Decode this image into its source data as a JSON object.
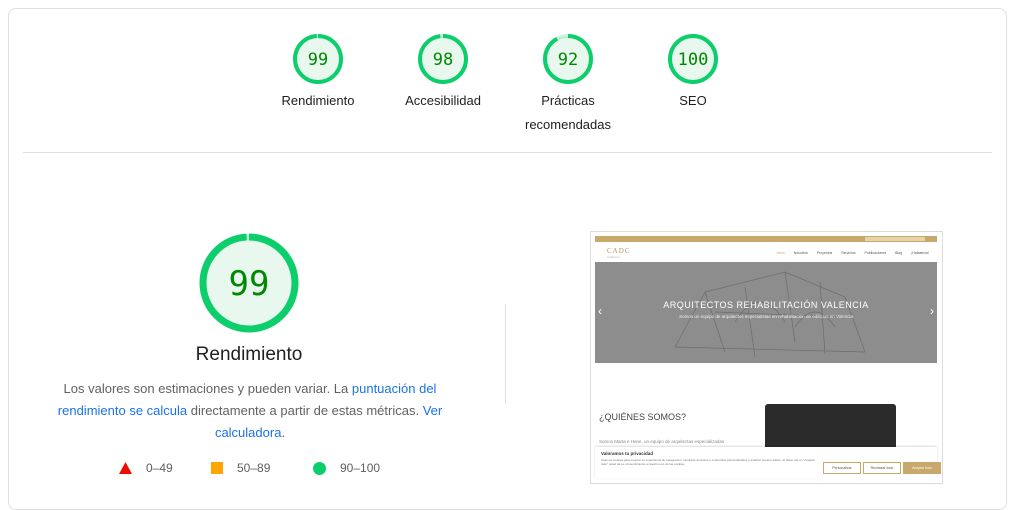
{
  "categories": [
    {
      "score": "99",
      "label": "Rendimiento",
      "fraction": 0.99
    },
    {
      "score": "98",
      "label": "Accesibilidad",
      "fraction": 0.98
    },
    {
      "score": "92",
      "label": "Prácticas recomendadas",
      "fraction": 0.92
    },
    {
      "score": "100",
      "label": "SEO",
      "fraction": 1.0
    }
  ],
  "main": {
    "score": "99",
    "fraction": 0.99,
    "title": "Rendimiento",
    "desc_before": "Los valores son estimaciones y pueden variar. La ",
    "desc_link1": "puntuación del rendimiento se calcula",
    "desc_middle": " directamente a partir de estas métricas. ",
    "desc_link2": "Ver calculadora",
    "desc_after": "."
  },
  "legend": [
    {
      "range": "0–49",
      "icon": "red-triangle-icon",
      "color": "#eb0f00"
    },
    {
      "range": "50–89",
      "icon": "orange-square-icon",
      "color": "#ffa400"
    },
    {
      "range": "90–100",
      "icon": "green-circle-icon",
      "color": "#0cce6b"
    }
  ],
  "colors": {
    "pass": "#0cce6b",
    "pass_fill": "#e8f8ee",
    "pass_text": "#008800",
    "link": "#1a73e8"
  },
  "screenshot": {
    "logo": "CADC",
    "logo_sub": "arquitectos",
    "menu": [
      "Inicio",
      "Nosotros",
      "Proyectos",
      "Servicios",
      "Publicaciones",
      "Blog",
      "¡Hablamos!"
    ],
    "hero_title": "ARQUITECTOS REHABILITACIÓN VALENCIA",
    "hero_subtitle": "Somos un equipo de arquitectos especialistas en rehabilitación de edificios en Valencia",
    "section_title": "¿QUIÉNES SOMOS?",
    "section_text": "Somos Marta e Hene, un equipo de arquitectas especializadas",
    "cookie_title": "Valoramos tu privacidad",
    "cookie_text": "Usamos cookies para mejorar su experiencia de navegación, mostrarle anuncios o contenidos personalizados y analizar nuestro tráfico. Al hacer clic en \"Aceptar todo\" usted da su consentimiento a nuestro uso de las cookies.",
    "btn_customize": "Personalizar",
    "btn_reject": "Rechazar todo",
    "btn_accept": "Aceptar todo"
  }
}
